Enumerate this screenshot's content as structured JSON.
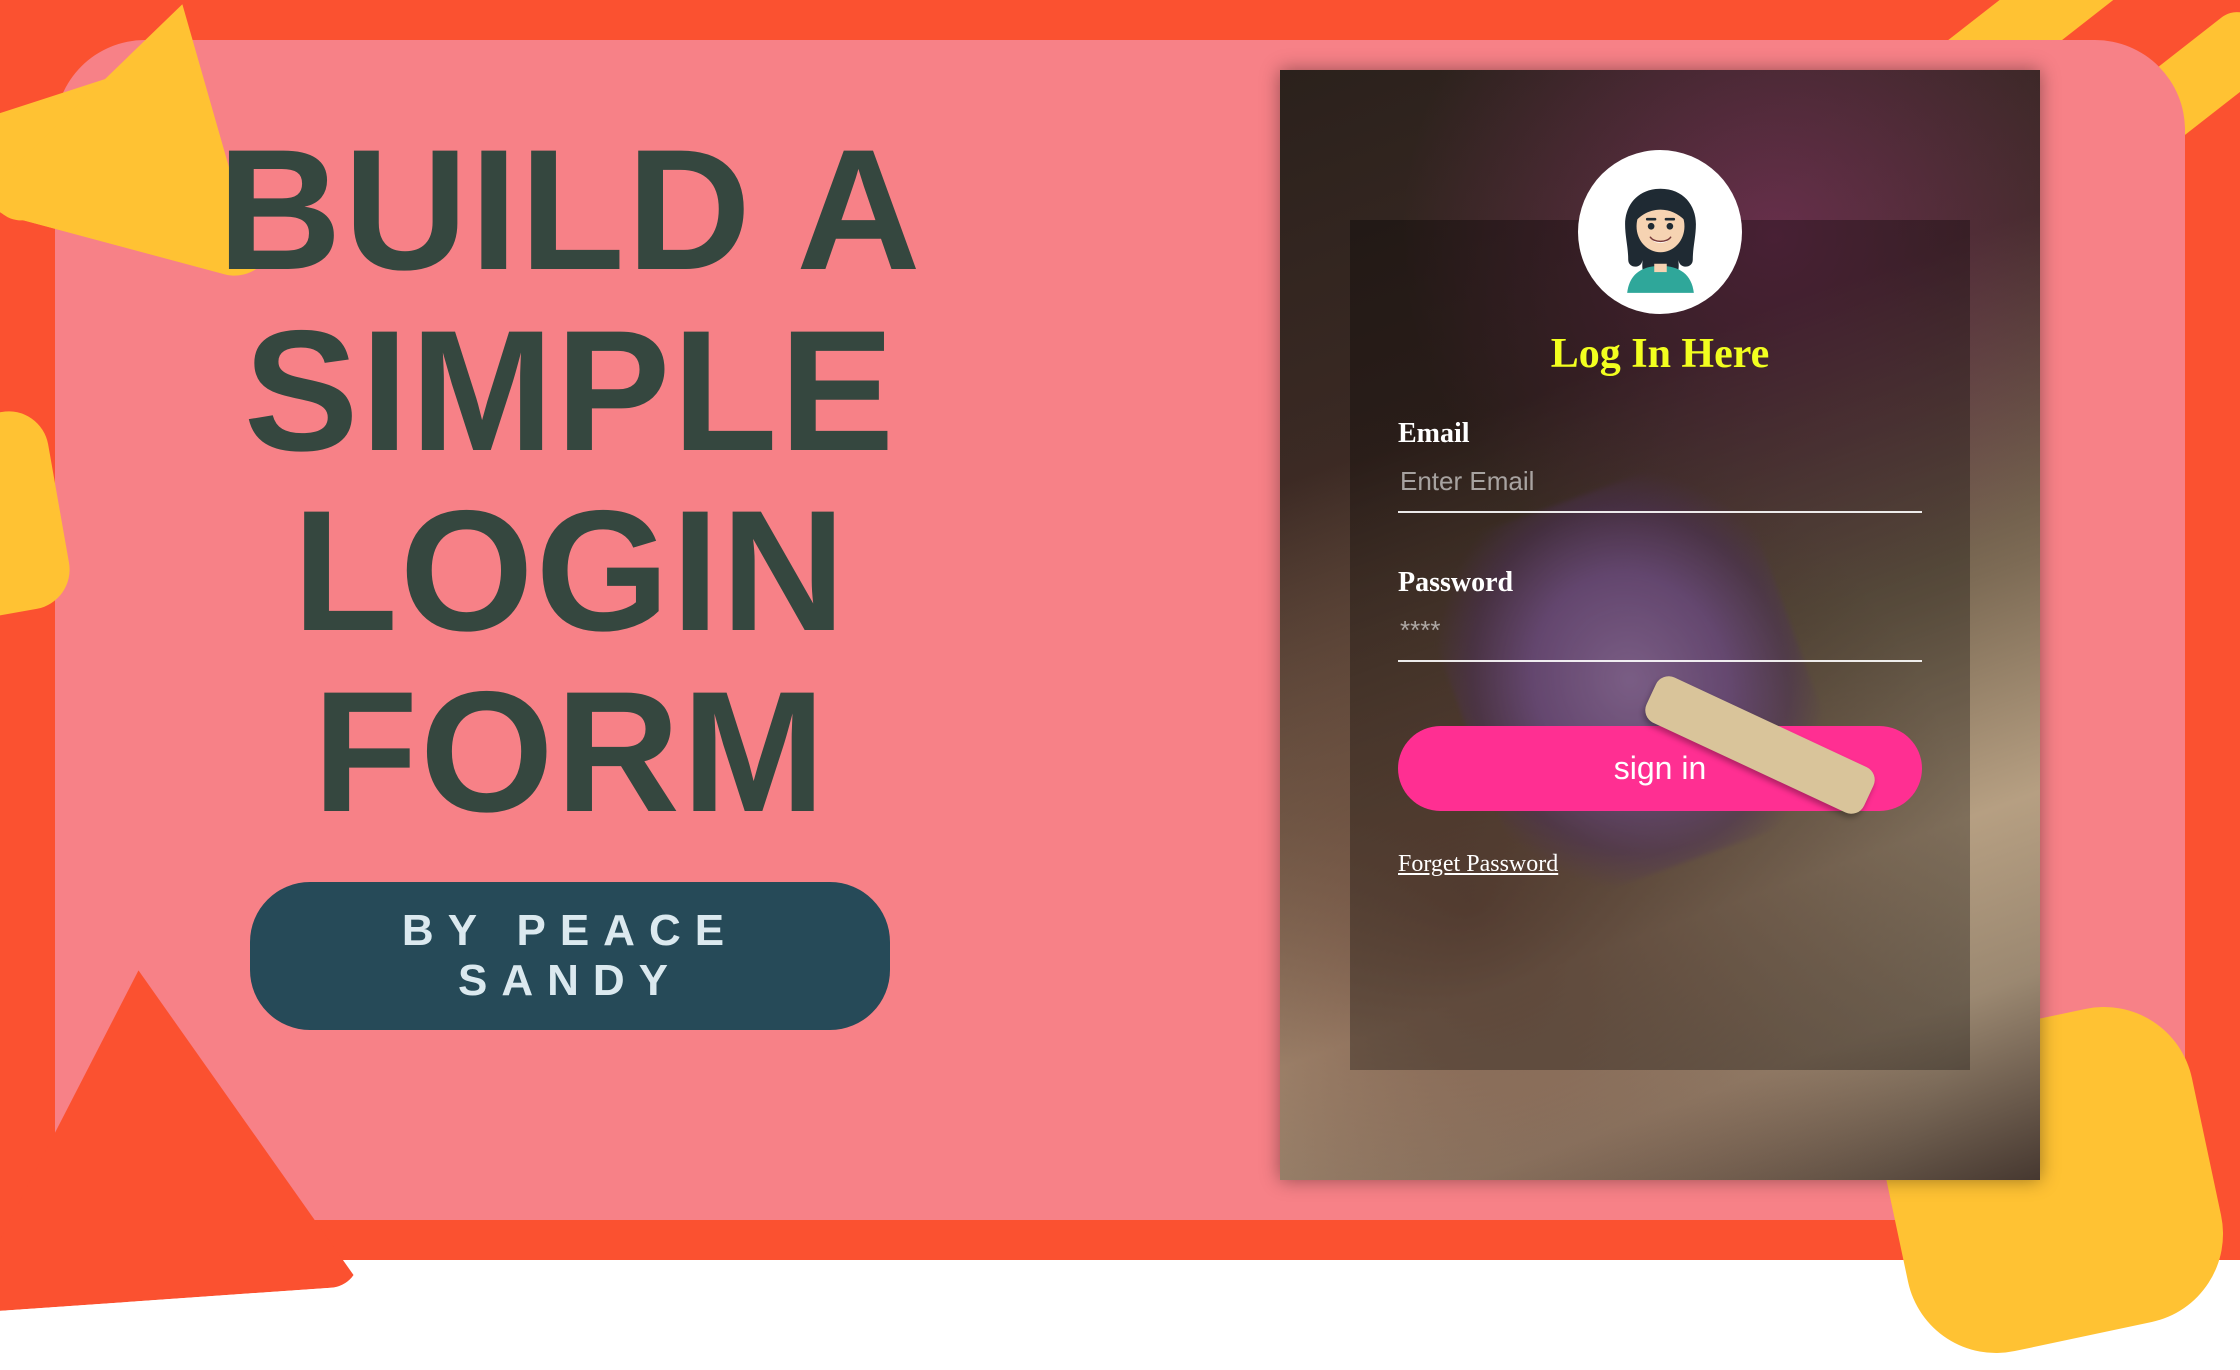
{
  "colors": {
    "orange": "#fb5130",
    "pink": "#f78187",
    "yellow": "#ffc233",
    "title": "#35473f",
    "pill_bg": "#264a58",
    "card_title": "#f2ff1f",
    "button": "#ff2f92"
  },
  "left": {
    "title_line1": "BUILD A",
    "title_line2": "SIMPLE",
    "title_line3": "LOGIN FORM",
    "byline": "BY PEACE SANDY"
  },
  "login": {
    "title": "Log In Here",
    "email_label": "Email",
    "email_placeholder": "Enter Email",
    "password_label": "Password",
    "password_placeholder": "****",
    "signin_label": "sign in",
    "forgot_label": "Forget Password"
  }
}
